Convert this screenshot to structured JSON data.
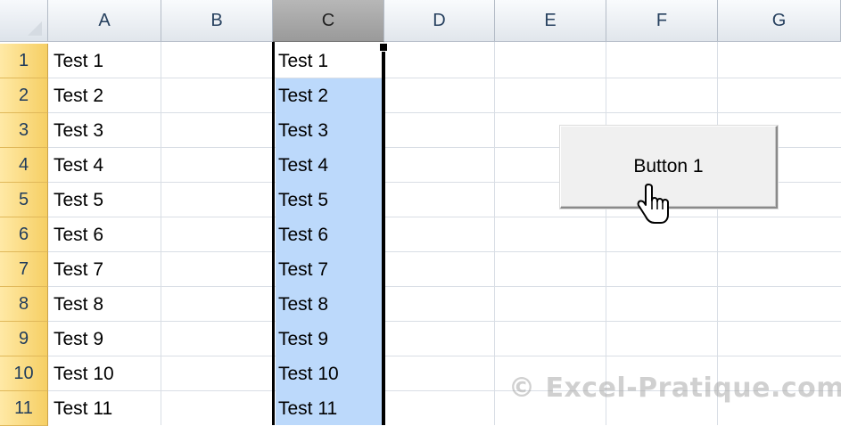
{
  "spreadsheet": {
    "columns": [
      "A",
      "B",
      "C",
      "D",
      "E",
      "F",
      "G"
    ],
    "selected_column": "C",
    "rows": [
      {
        "num": "1",
        "a": "Test 1",
        "c": "Test 1"
      },
      {
        "num": "2",
        "a": "Test 2",
        "c": "Test 2"
      },
      {
        "num": "3",
        "a": "Test 3",
        "c": "Test 3"
      },
      {
        "num": "4",
        "a": "Test 4",
        "c": "Test 4"
      },
      {
        "num": "5",
        "a": "Test 5",
        "c": "Test 5"
      },
      {
        "num": "6",
        "a": "Test 6",
        "c": "Test 6"
      },
      {
        "num": "7",
        "a": "Test 7",
        "c": "Test 7"
      },
      {
        "num": "8",
        "a": "Test 8",
        "c": "Test 8"
      },
      {
        "num": "9",
        "a": "Test 9",
        "c": "Test 9"
      },
      {
        "num": "10",
        "a": "Test 10",
        "c": "Test 10"
      },
      {
        "num": "11",
        "a": "Test 11",
        "c": "Test 11"
      }
    ]
  },
  "button": {
    "label": "Button 1"
  },
  "watermark": {
    "text": "© Excel-Pratique.com"
  },
  "colors": {
    "selection_fill": "#bcd9fb",
    "row_header": "#f6cf64",
    "selected_col_header": "#a5a5a5"
  }
}
